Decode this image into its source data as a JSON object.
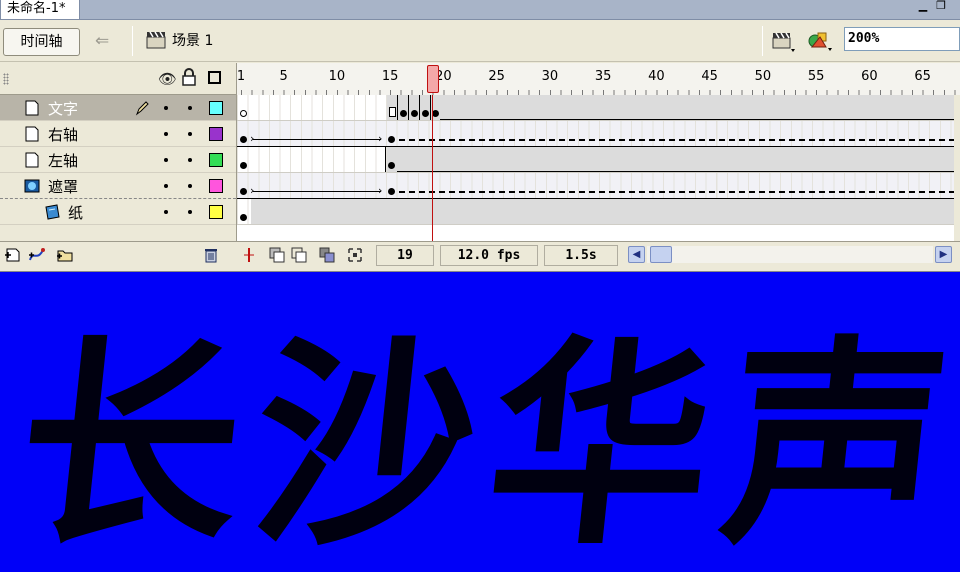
{
  "document": {
    "tab_title": "未命名-1*",
    "minimize_glyph": "▁",
    "restore_glyph": "❐"
  },
  "editbar": {
    "timeline_button_label": "时间轴",
    "back_glyph": "⇐",
    "scene_label": "场景 1",
    "zoom_value": "200%"
  },
  "timeline": {
    "ruler_numbers": [
      "1",
      "5",
      "10",
      "15",
      "20",
      "25",
      "30",
      "35",
      "40",
      "45",
      "50",
      "55",
      "60",
      "65"
    ],
    "current_frame": 19,
    "layers": [
      {
        "name": "文字",
        "selected": true,
        "color": "#66ffff",
        "icon": "layer-icon"
      },
      {
        "name": "右轴",
        "selected": false,
        "color": "#9933cc",
        "icon": "layer-icon"
      },
      {
        "name": "左轴",
        "selected": false,
        "color": "#33dd55",
        "icon": "layer-icon"
      },
      {
        "name": "遮罩",
        "selected": false,
        "color": "#ff55dd",
        "icon": "mask-layer-icon"
      },
      {
        "name": "纸",
        "selected": false,
        "color": "#ffff44",
        "icon": "masked-layer-icon"
      }
    ],
    "footer": {
      "frame_display": "19",
      "fps_display": "12.0 fps",
      "time_display": "1.5s"
    }
  },
  "stage": {
    "characters": [
      "长",
      "沙",
      "华",
      "声"
    ],
    "background_color": "#0000f8"
  }
}
